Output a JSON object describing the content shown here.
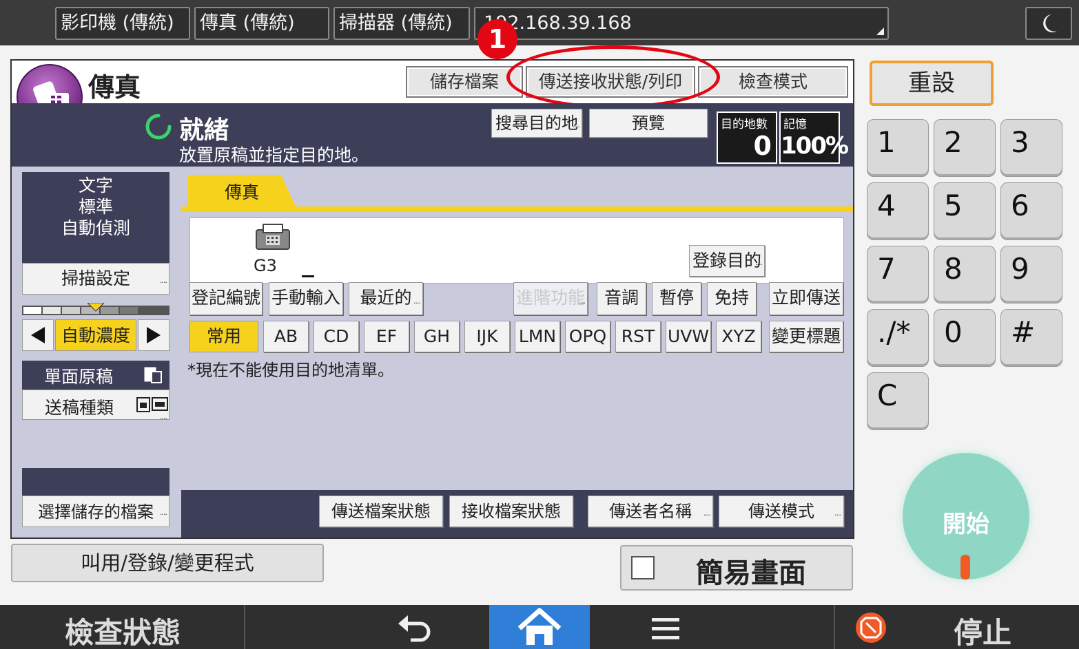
{
  "topbar": {
    "tabs": [
      "影印機 (傳統)",
      "傳真 (傳統)",
      "掃描器 (傳統)"
    ],
    "address": "192.168.39.168"
  },
  "annotation": {
    "number": "1",
    "color": "#e30613"
  },
  "app": {
    "title": "傳真",
    "header_buttons": [
      "儲存檔案",
      "傳送接收狀態/列印",
      "檢查模式"
    ],
    "status": "就緒",
    "message": "放置原稿並指定目的地。",
    "search_dest": "搜尋目的地",
    "preview": "預覽",
    "dest_count_label": "目的地數",
    "dest_count": "0",
    "memory_label": "記憶",
    "memory": "100%"
  },
  "left": {
    "settings_lines": [
      "文字",
      "標準",
      "自動偵測"
    ],
    "scan_settings": "掃描設定",
    "density": "自動濃度",
    "single_sided": "單面原稿",
    "feed_type": "送稿種類",
    "select_stored": "選擇儲存的檔案"
  },
  "content": {
    "tab": "傳真",
    "line_label": "G3",
    "register_dest": "登錄目的",
    "row_buttons": [
      "登記編號",
      "手動輸入",
      "最近的",
      "進階功能",
      "音調",
      "暫停",
      "免持",
      "立即傳送"
    ],
    "index_tabs": [
      "常用",
      "AB",
      "CD",
      "EF",
      "GH",
      "IJK",
      "LMN",
      "OPQ",
      "RST",
      "UVW",
      "XYZ",
      "變更標題"
    ],
    "notice": "*現在不能使用目的地清單。",
    "bottom_buttons": [
      "傳送檔案狀態",
      "接收檔案狀態",
      "傳送者名稱",
      "傳送模式"
    ]
  },
  "below": {
    "program": "叫用/登錄/變更程式",
    "simple_screen": "簡易畫面"
  },
  "keypad": {
    "reset": "重設",
    "keys": [
      "1",
      "2",
      "3",
      "4",
      "5",
      "6",
      "7",
      "8",
      "9",
      "./*",
      "0",
      "#",
      "C"
    ],
    "start": "開始"
  },
  "nav": {
    "check_status": "檢查狀態",
    "stop": "停止"
  },
  "colors": {
    "accent_yellow": "#f7d21c",
    "reset_border": "#f0a030",
    "start_green": "#8fd7c4",
    "panel_dark": "#3d3f58",
    "panel_light": "#c9cbdd",
    "home_blue": "#2f7fd8",
    "stop_orange": "#f05a28"
  }
}
